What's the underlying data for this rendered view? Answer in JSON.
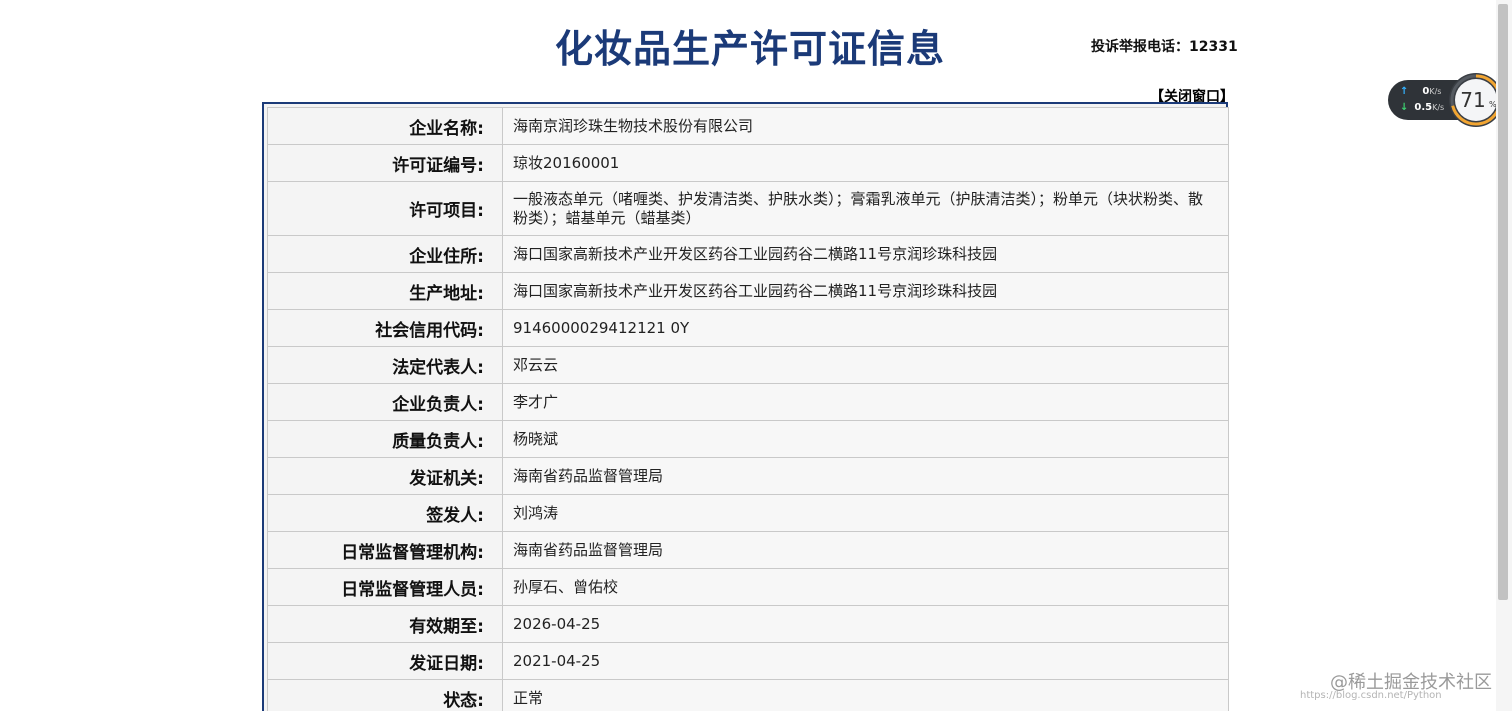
{
  "page_title": "化妆品生产许可证信息",
  "hotline": "投诉举报电话：12331",
  "close_window": "【关闭窗口】",
  "rows": [
    {
      "label": "企业名称:",
      "value": "海南京润珍珠生物技术股份有限公司"
    },
    {
      "label": "许可证编号:",
      "value": "琼妆20160001"
    },
    {
      "label": "许可项目:",
      "value": "一般液态单元（啫喱类、护发清洁类、护肤水类）；膏霜乳液单元（护肤清洁类）；粉单元（块状粉类、散粉类）；蜡基单元（蜡基类）"
    },
    {
      "label": "企业住所:",
      "value": "海口国家高新技术产业开发区药谷工业园药谷二横路11号京润珍珠科技园"
    },
    {
      "label": "生产地址:",
      "value": "海口国家高新技术产业开发区药谷工业园药谷二横路11号京润珍珠科技园"
    },
    {
      "label": "社会信用代码:",
      "value": "9146000029412121 0Y"
    },
    {
      "label": "法定代表人:",
      "value": "邓云云"
    },
    {
      "label": "企业负责人:",
      "value": "李才广"
    },
    {
      "label": "质量负责人:",
      "value": "杨晓斌"
    },
    {
      "label": "发证机关:",
      "value": "海南省药品监督管理局"
    },
    {
      "label": "签发人:",
      "value": "刘鸿涛"
    },
    {
      "label": "日常监督管理机构:",
      "value": "海南省药品监督管理局"
    },
    {
      "label": "日常监督管理人员:",
      "value": "孙厚石、曾佑校"
    },
    {
      "label": "有效期至:",
      "value": "2026-04-25"
    },
    {
      "label": "发证日期:",
      "value": "2021-04-25"
    },
    {
      "label": "状态:",
      "value": "正常"
    }
  ],
  "speed_widget": {
    "upload": "0",
    "upload_unit": "K/s",
    "download": "0.5",
    "download_unit": "K/s",
    "percent": "71",
    "percent_unit": "%",
    "percent_value": 71
  },
  "watermark": "@稀土掘金技术社区",
  "watermark_sub": "https://blog.csdn.net/Python",
  "colors": {
    "title": "#1b3a78",
    "border": "#1b3a78",
    "ring_accent": "#f2a531",
    "ring_green": "#38c178"
  }
}
